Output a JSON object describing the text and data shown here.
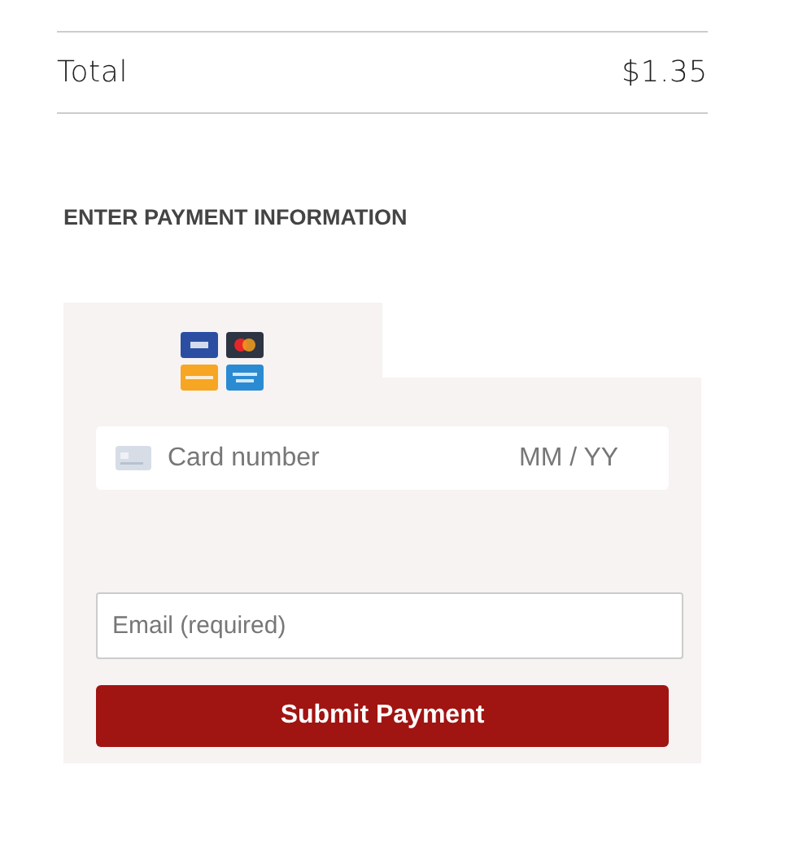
{
  "summary": {
    "label": "Total",
    "amount": "$1.35"
  },
  "payment": {
    "heading": "ENTER PAYMENT INFORMATION",
    "card_field": {
      "placeholder": "Card number",
      "expiry_placeholder": "MM / YY"
    },
    "email_field": {
      "placeholder": "Email (required)"
    },
    "submit": "Submit Payment"
  }
}
